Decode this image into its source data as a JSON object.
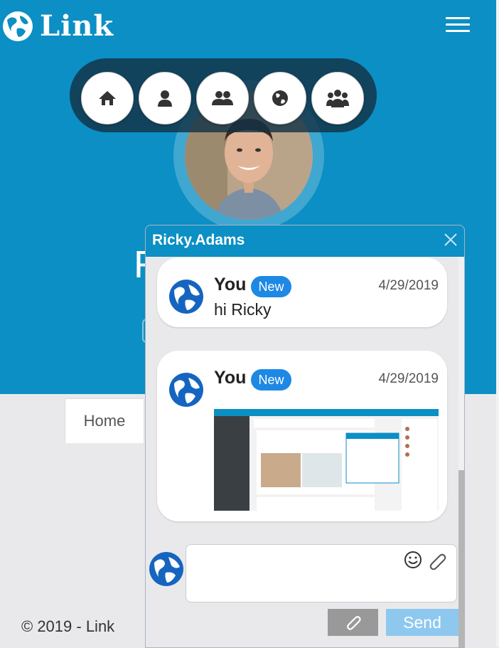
{
  "brand": {
    "name": "Link"
  },
  "colors": {
    "primary": "#0b8fc4",
    "badge": "#1e88e5",
    "send": "#8ec8ef"
  },
  "nav": {
    "items": [
      {
        "icon": "home-icon"
      },
      {
        "icon": "user-icon"
      },
      {
        "icon": "friends-icon"
      },
      {
        "icon": "globe-icon"
      },
      {
        "icon": "groups-icon"
      }
    ]
  },
  "profile": {
    "heading_initial": "R"
  },
  "tabs": {
    "home_label": "Home"
  },
  "footer": {
    "copyright": "© 2019 - Link"
  },
  "chat": {
    "title": "Ricky.Adams",
    "messages": [
      {
        "sender": "You",
        "badge": "New",
        "date": "4/29/2019",
        "text": "hi Ricky"
      },
      {
        "sender": "You",
        "badge": "New",
        "date": "4/29/2019",
        "text": ""
      }
    ],
    "composer": {
      "placeholder": ""
    },
    "send_label": "Send"
  }
}
